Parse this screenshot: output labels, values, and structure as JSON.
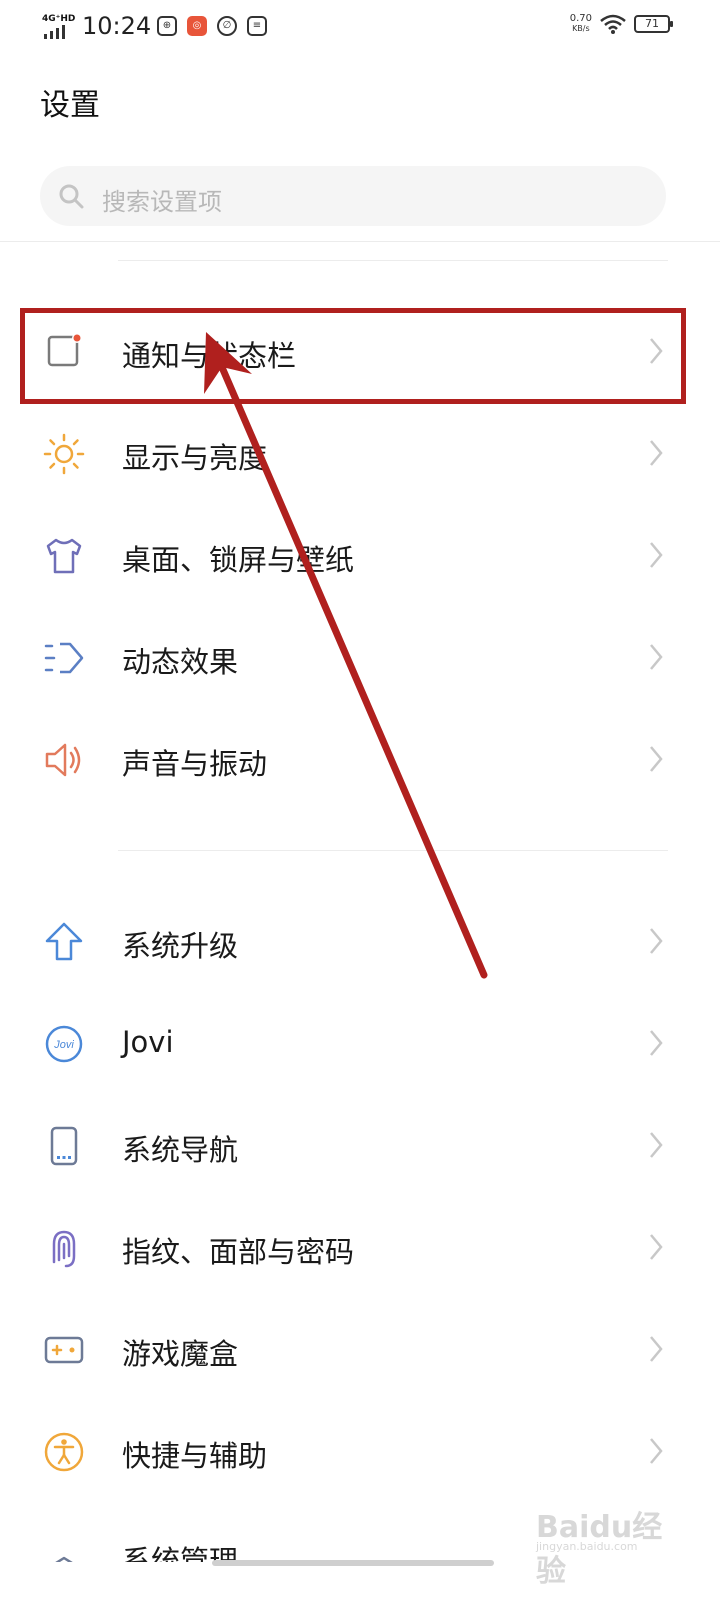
{
  "status_bar": {
    "network": "4G⁺HD",
    "time": "10:24",
    "net_speed_value": "0.70",
    "net_speed_unit": "KB/s",
    "battery": "71"
  },
  "page_title": "设置",
  "search": {
    "placeholder": "搜索设置项"
  },
  "section1": [
    {
      "label": "通知与状态栏",
      "icon": "notification-icon",
      "color": "#7a7a7a"
    },
    {
      "label": "显示与亮度",
      "icon": "brightness-icon",
      "color": "#f0a73a"
    },
    {
      "label": "桌面、锁屏与壁纸",
      "icon": "tshirt-icon",
      "color": "#6f6fb8"
    },
    {
      "label": "动态效果",
      "icon": "motion-icon",
      "color": "#5b7fc4"
    },
    {
      "label": "声音与振动",
      "icon": "speaker-icon",
      "color": "#e27a5c"
    }
  ],
  "section2": [
    {
      "label": "系统升级",
      "icon": "upgrade-arrow-icon",
      "color": "#4b88d8"
    },
    {
      "label": "Jovi",
      "icon": "jovi-icon",
      "color": "#4b88d8"
    },
    {
      "label": "系统导航",
      "icon": "phone-nav-icon",
      "color": "#6d7a96"
    },
    {
      "label": "指纹、面部与密码",
      "icon": "fingerprint-icon",
      "color": "#7b6fc4"
    },
    {
      "label": "游戏魔盒",
      "icon": "gamepad-icon",
      "color": "#6d7a96"
    },
    {
      "label": "快捷与辅助",
      "icon": "accessibility-icon",
      "color": "#f0a73a"
    },
    {
      "label": "系统管理",
      "icon": "system-manage-icon",
      "color": "#6d7a96"
    }
  ],
  "annotation": {
    "color": "#b0201e"
  },
  "watermark": {
    "brand": "Baidu经验",
    "site": "jingyan.baidu.com"
  }
}
